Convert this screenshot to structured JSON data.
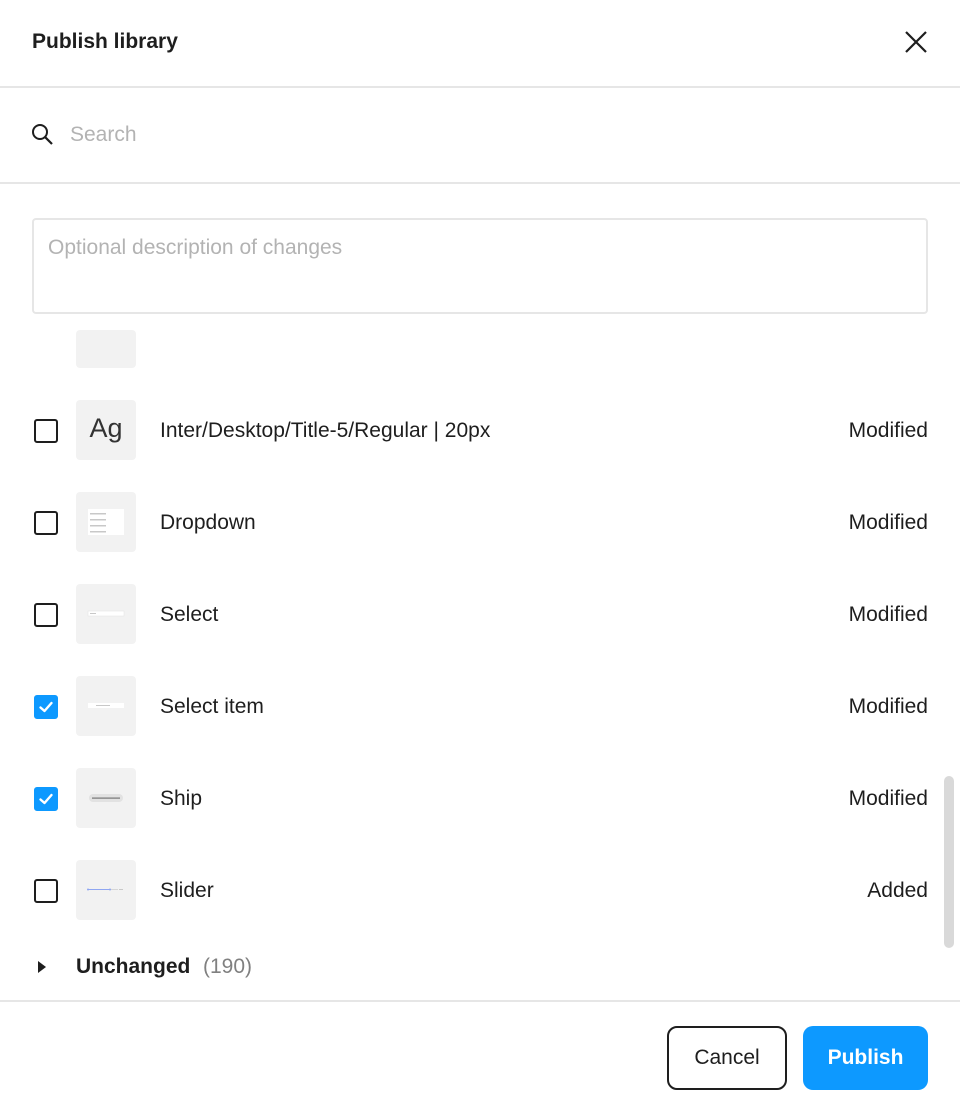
{
  "dialog": {
    "title": "Publish library",
    "close_icon": "close-icon"
  },
  "search": {
    "placeholder": "Search",
    "value": "",
    "icon": "search-icon"
  },
  "description": {
    "placeholder": "Optional description of changes",
    "value": ""
  },
  "changes": [
    {
      "name": "Inter/Desktop/Title-5/Regular | 20px",
      "status": "Modified",
      "checked": false,
      "thumb": "Ag"
    },
    {
      "name": "Dropdown",
      "status": "Modified",
      "checked": false,
      "thumb": "dropdown-preview"
    },
    {
      "name": "Select",
      "status": "Modified",
      "checked": false,
      "thumb": "select-preview"
    },
    {
      "name": "Select item",
      "status": "Modified",
      "checked": true,
      "thumb": "select-item-preview"
    },
    {
      "name": "Ship",
      "status": "Modified",
      "checked": true,
      "thumb": "chip-preview"
    },
    {
      "name": "Slider",
      "status": "Added",
      "checked": false,
      "thumb": "slider-preview"
    }
  ],
  "unchanged": {
    "label": "Unchanged",
    "count": "(190)"
  },
  "footer": {
    "cancel_label": "Cancel",
    "publish_label": "Publish"
  },
  "colors": {
    "accent": "#0d99ff",
    "divider": "#e6e6e6",
    "thumb_bg": "#f2f2f2"
  }
}
